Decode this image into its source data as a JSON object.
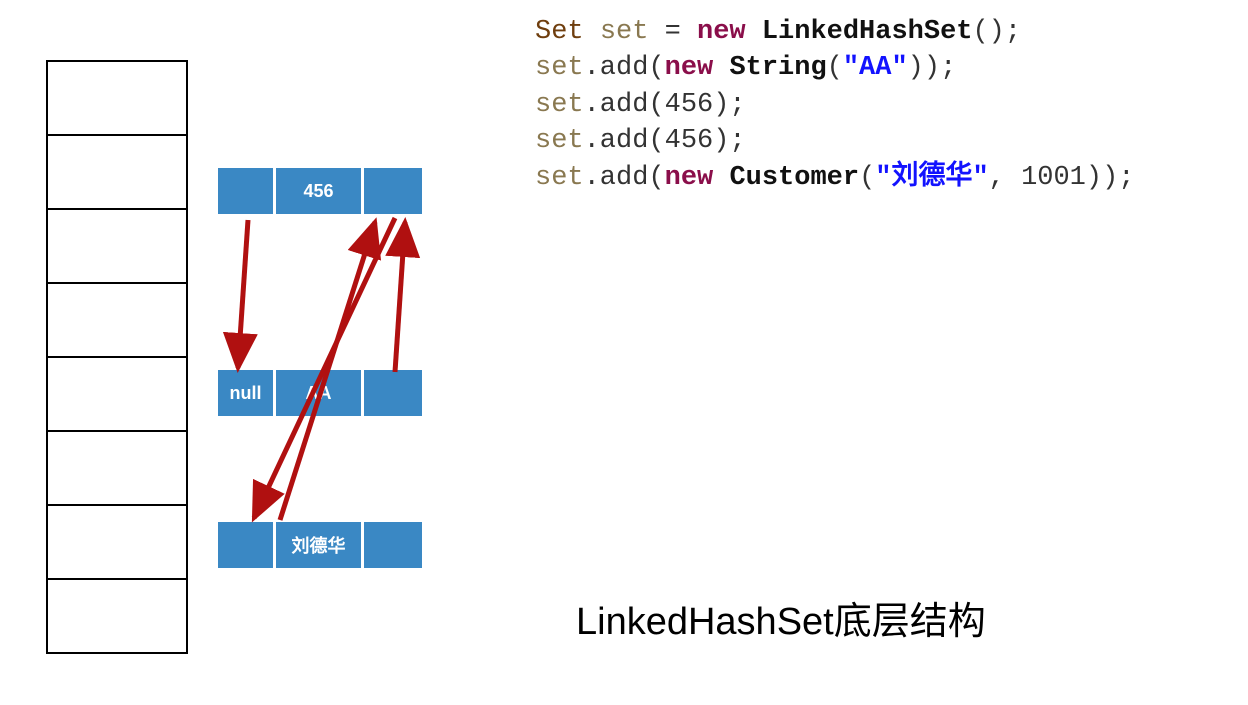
{
  "code": {
    "line1": {
      "type": "Set",
      "var": "set",
      "new": "new",
      "class": "LinkedHashSet"
    },
    "line2": {
      "var": "set",
      "method": ".add(",
      "new": "new",
      "class": "String",
      "arg": "\"AA\""
    },
    "line3": {
      "var": "set",
      "method": ".add(",
      "arg": "456"
    },
    "line4": {
      "var": "set",
      "method": ".add(",
      "arg": "456"
    },
    "line5": {
      "var": "set",
      "method": ".add(",
      "new": "new",
      "class": "Customer",
      "arg1": "\"刘德华\"",
      "arg2": "1001"
    }
  },
  "nodes": {
    "node456": {
      "prev": "",
      "data": "456",
      "next": ""
    },
    "nodeAA": {
      "prev": "null",
      "data": "AA",
      "next": ""
    },
    "nodeLDH": {
      "prev": "",
      "data": "刘德华",
      "next": ""
    }
  },
  "caption": "LinkedHashSet底层结构",
  "bucket_count": 8
}
